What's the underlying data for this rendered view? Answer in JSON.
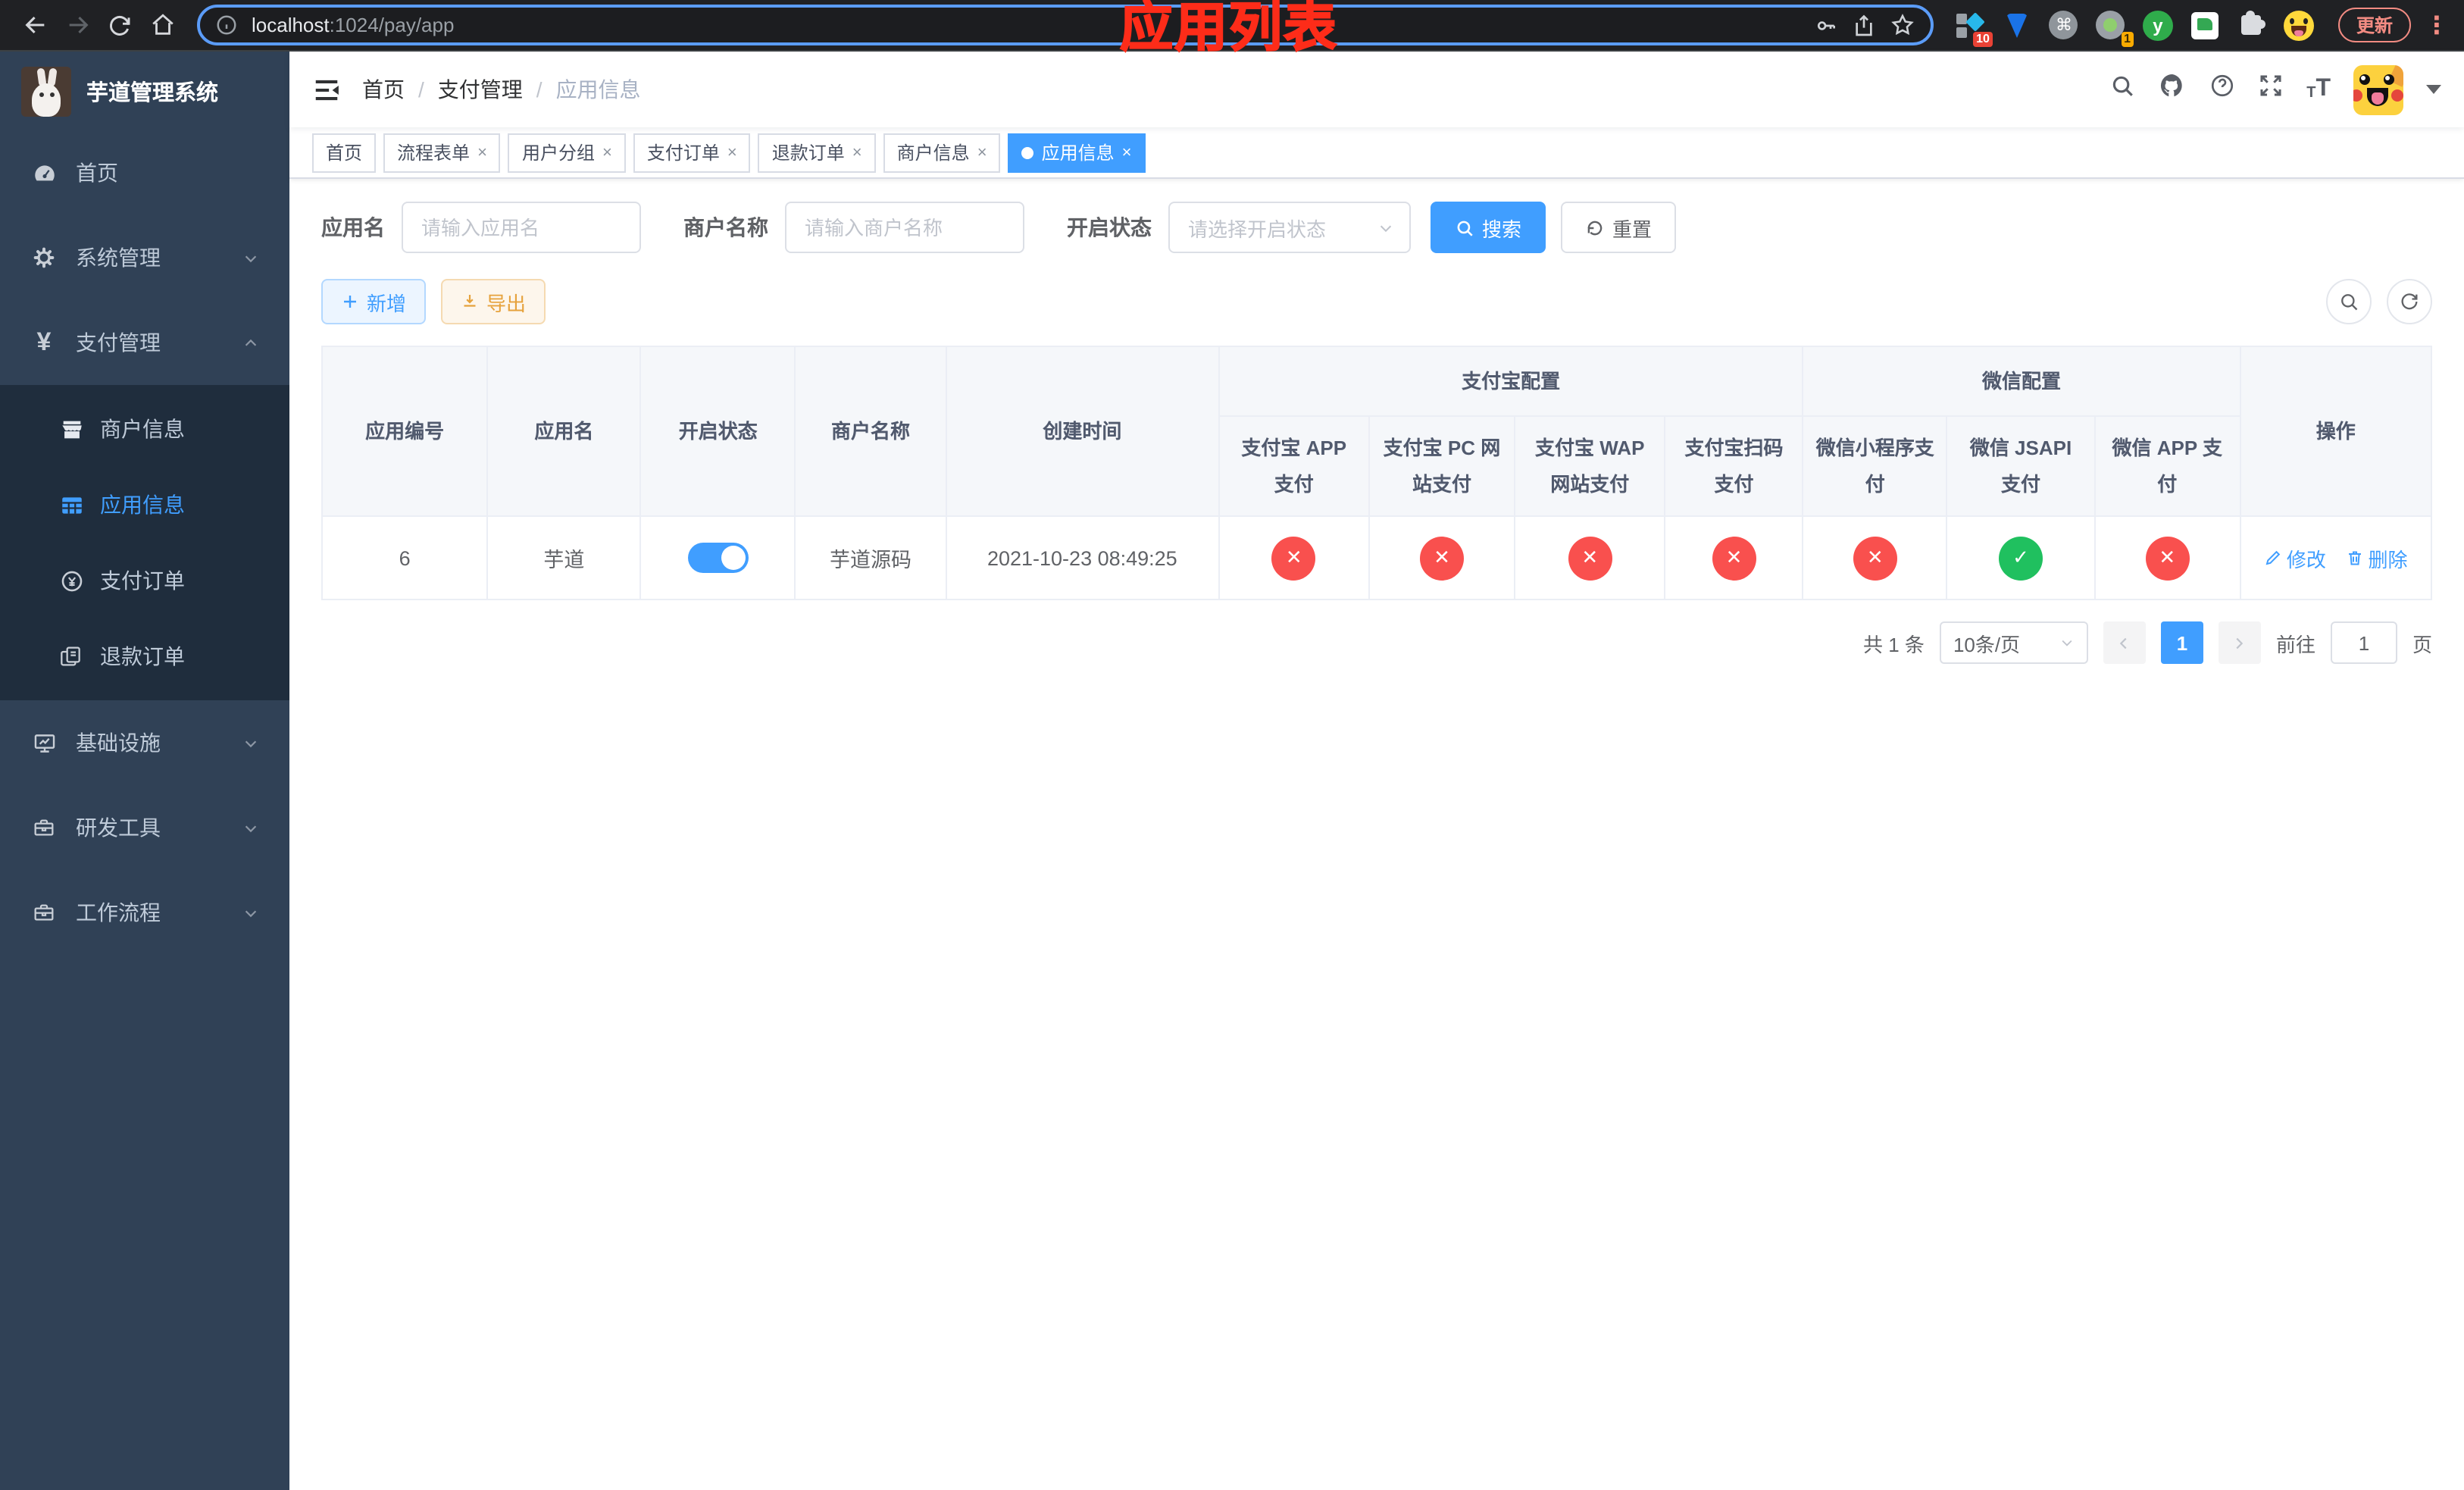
{
  "colors": {
    "accent": "#409eff",
    "success": "#20c05f",
    "danger": "#f9504e",
    "warning": "#e6a23c",
    "annotation_red": "#fe2c19",
    "sidebar_bg": "#304156",
    "submenu_bg": "#1f2d3d"
  },
  "browser": {
    "url_host": "localhost",
    "url_path": ":1024/pay/app",
    "update_label": "更新",
    "extension_badge_10": "10",
    "extension_badge_1": "1"
  },
  "sidebar": {
    "title": "芋道管理系统",
    "items": [
      {
        "label": "首页"
      },
      {
        "label": "系统管理"
      },
      {
        "label": "支付管理"
      },
      {
        "label": "基础设施"
      },
      {
        "label": "研发工具"
      },
      {
        "label": "工作流程"
      }
    ],
    "submenu": [
      {
        "label": "商户信息"
      },
      {
        "label": "应用信息"
      },
      {
        "label": "支付订单"
      },
      {
        "label": "退款订单"
      }
    ]
  },
  "header": {
    "breadcrumb": [
      "首页",
      "支付管理",
      "应用信息"
    ],
    "separator": "/",
    "annotation": "应用列表"
  },
  "tabs": [
    {
      "label": "首页"
    },
    {
      "label": "流程表单"
    },
    {
      "label": "用户分组"
    },
    {
      "label": "支付订单"
    },
    {
      "label": "退款订单"
    },
    {
      "label": "商户信息"
    },
    {
      "label": "应用信息"
    }
  ],
  "filters": {
    "app_name_label": "应用名",
    "app_name_placeholder": "请输入应用名",
    "merchant_label": "商户名称",
    "merchant_placeholder": "请输入商户名称",
    "status_label": "开启状态",
    "status_placeholder": "请选择开启状态",
    "search_label": "搜索",
    "reset_label": "重置"
  },
  "toolbar": {
    "add_label": "新增",
    "export_label": "导出"
  },
  "table": {
    "headers": {
      "app_id": "应用编号",
      "app_name": "应用名",
      "status": "开启状态",
      "merchant": "商户名称",
      "created": "创建时间",
      "alipay_group": "支付宝配置",
      "wechat_group": "微信配置",
      "actions": "操作"
    },
    "channel_headers": [
      "支付宝 APP 支付",
      "支付宝 PC 网站支付",
      "支付宝 WAP 网站支付",
      "支付宝扫码支付",
      "微信小程序支付",
      "微信 JSAPI 支付",
      "微信 APP 支付"
    ],
    "row": {
      "app_id": "6",
      "app_name": "芋道",
      "status_on": true,
      "merchant": "芋道源码",
      "created": "2021-10-23 08:49:25",
      "channels": [
        {
          "state": "off",
          "glyph": "✕"
        },
        {
          "state": "off",
          "glyph": "✕"
        },
        {
          "state": "off",
          "glyph": "✕"
        },
        {
          "state": "off",
          "glyph": "✕"
        },
        {
          "state": "off",
          "glyph": "✕"
        },
        {
          "state": "on",
          "glyph": "✓"
        },
        {
          "state": "off",
          "glyph": "✕"
        }
      ],
      "edit_label": "修改",
      "delete_label": "删除"
    }
  },
  "pagination": {
    "total": "共 1 条",
    "page_size": "10条/页",
    "page": "1",
    "goto_label": "前往",
    "goto_value": "1",
    "goto_suffix": "页"
  }
}
